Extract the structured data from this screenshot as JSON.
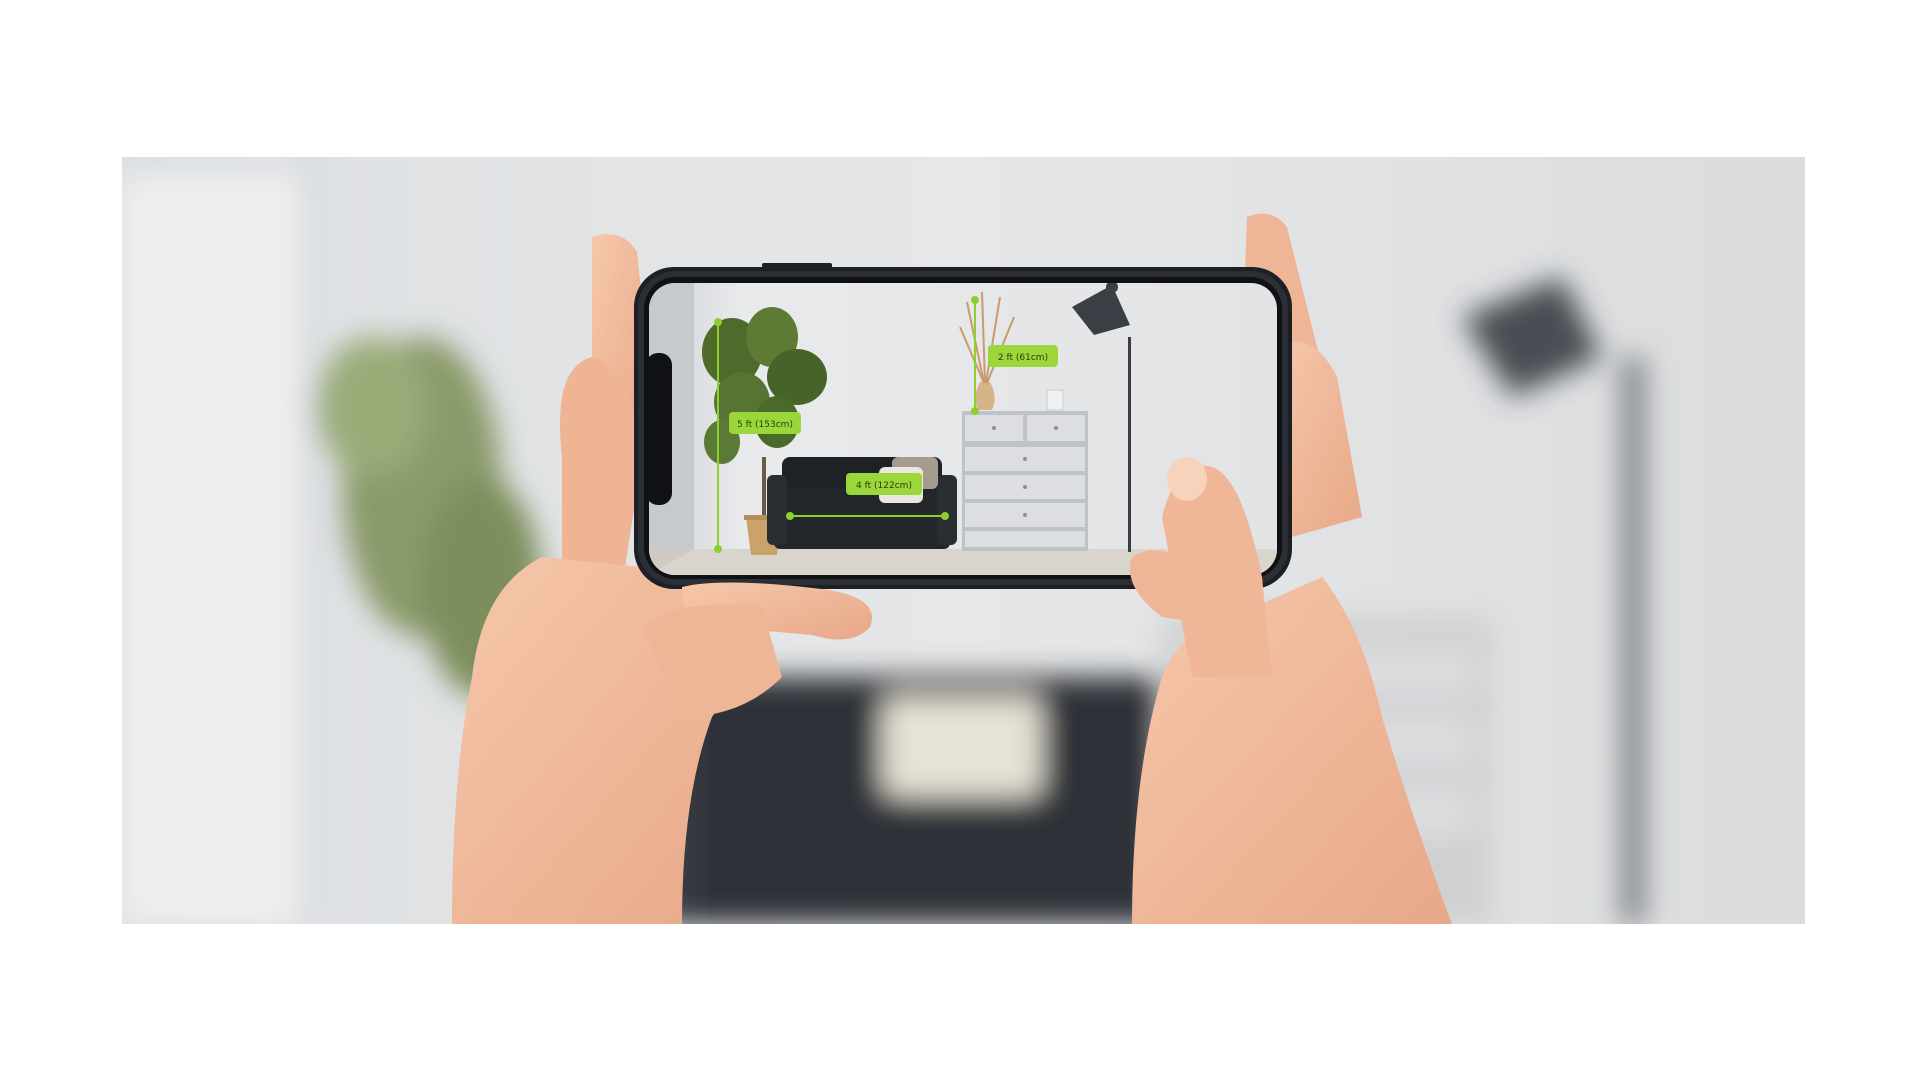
{
  "measurements": {
    "plant_height": "5 ft (153cm)",
    "sofa_width": "4 ft (122cm)",
    "vase_height": "2 ft (61cm)"
  },
  "colors": {
    "measure_accent": "#8ecf2e",
    "label_fill": "#9bd63a",
    "phone_frame": "#1c1f24",
    "skin": "#f0b99a"
  }
}
